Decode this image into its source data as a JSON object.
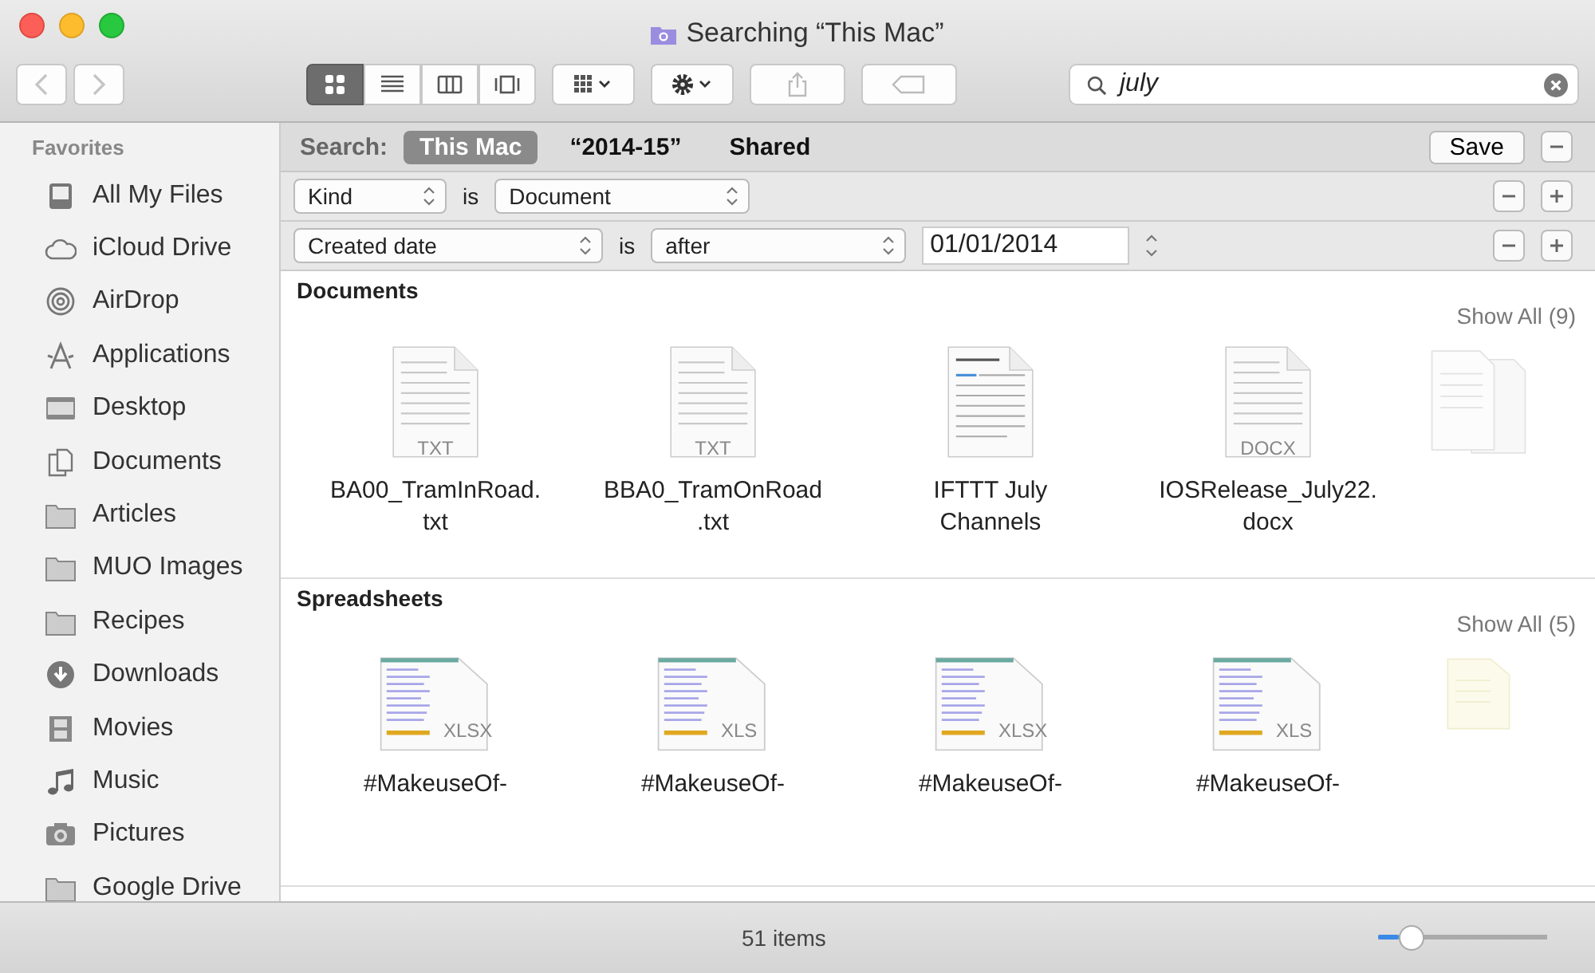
{
  "window": {
    "title": "Searching “This Mac”"
  },
  "toolbar": {
    "view_modes": [
      {
        "kind": "icons",
        "selected": true
      },
      {
        "kind": "list",
        "selected": false
      },
      {
        "kind": "columns",
        "selected": false
      },
      {
        "kind": "coverflow",
        "selected": false
      }
    ],
    "search": {
      "value": "july"
    }
  },
  "sidebar": {
    "heading": "Favorites",
    "items": [
      {
        "label": "All My Files",
        "kind": "tray"
      },
      {
        "label": "iCloud Drive",
        "kind": "cloud"
      },
      {
        "label": "AirDrop",
        "kind": "airdrop"
      },
      {
        "label": "Applications",
        "kind": "apps"
      },
      {
        "label": "Desktop",
        "kind": "desktop"
      },
      {
        "label": "Documents",
        "kind": "docs"
      },
      {
        "label": "Articles",
        "kind": "folder"
      },
      {
        "label": "MUO Images",
        "kind": "folder"
      },
      {
        "label": "Recipes",
        "kind": "folder"
      },
      {
        "label": "Downloads",
        "kind": "download"
      },
      {
        "label": "Movies",
        "kind": "film"
      },
      {
        "label": "Music",
        "kind": "note"
      },
      {
        "label": "Pictures",
        "kind": "camera"
      },
      {
        "label": "Google Drive",
        "kind": "folder"
      }
    ]
  },
  "search_bar": {
    "label": "Search:",
    "scopes": [
      {
        "label": "This Mac",
        "selected": true
      },
      {
        "label": "“2014-15”",
        "selected": false
      },
      {
        "label": "Shared",
        "selected": false
      }
    ],
    "save": "Save"
  },
  "criteria": [
    {
      "attribute": "Kind",
      "operator": "is",
      "value": "Document"
    },
    {
      "attribute": "Created date",
      "operator": "is",
      "value": "after",
      "date": "01/01/2014"
    }
  ],
  "sections": [
    {
      "title": "Documents",
      "show_all": "Show All (9)",
      "files": [
        {
          "kind": "text",
          "badge": "TXT",
          "lines": [
            "BA00_TramInRoad.",
            "txt"
          ]
        },
        {
          "kind": "text",
          "badge": "TXT",
          "lines": [
            "BBA0_TramOnRoad",
            ".txt"
          ]
        },
        {
          "kind": "preview",
          "lines": [
            "IFTTT July",
            "Channels"
          ]
        },
        {
          "kind": "text",
          "badge": "DOCX",
          "lines": [
            "IOSRelease_July22.",
            "docx"
          ]
        },
        {
          "kind": "stack"
        }
      ]
    },
    {
      "title": "Spreadsheets",
      "show_all": "Show All (5)",
      "files": [
        {
          "kind": "sheet",
          "badge": "XLSX",
          "lines": [
            "#MakeuseOf-"
          ]
        },
        {
          "kind": "sheet",
          "badge": "XLS",
          "lines": [
            "#MakeuseOf-"
          ]
        },
        {
          "kind": "sheet",
          "badge": "XLSX",
          "lines": [
            "#MakeuseOf-"
          ]
        },
        {
          "kind": "sheet",
          "badge": "XLS",
          "lines": [
            "#MakeuseOf-"
          ]
        },
        {
          "kind": "faded"
        }
      ]
    }
  ],
  "status_bar": {
    "text": "51 items",
    "zoom": {
      "level": 0.12
    }
  }
}
